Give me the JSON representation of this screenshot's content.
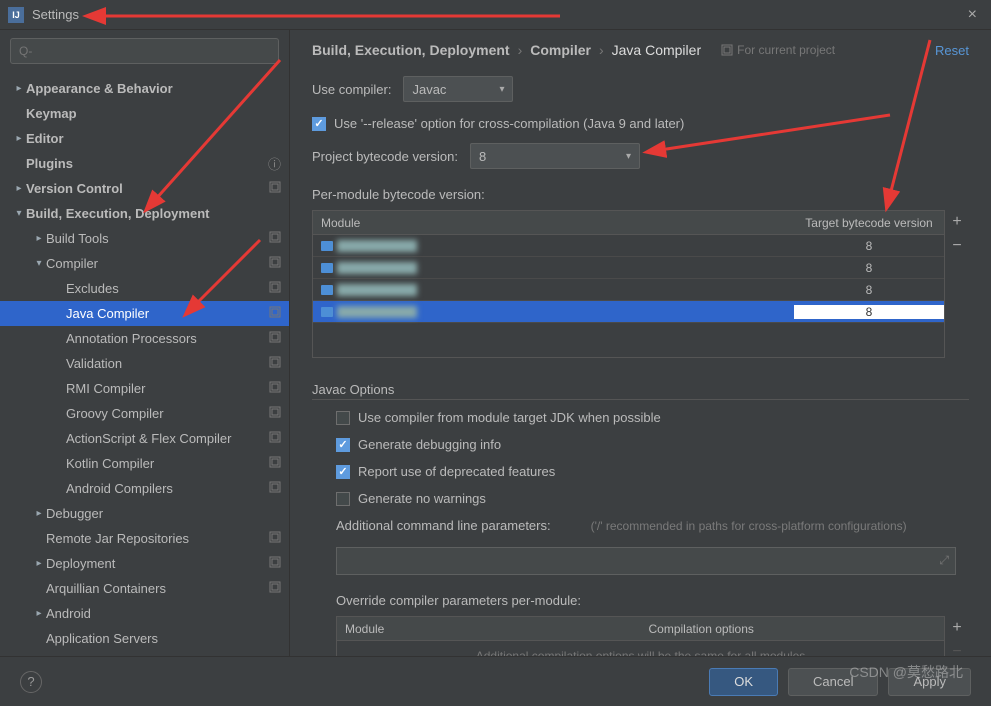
{
  "titlebar": {
    "title": "Settings",
    "close_icon": "×"
  },
  "search": {
    "placeholder": "Q-"
  },
  "sidebar": [
    {
      "label": "Appearance & Behavior",
      "lvl": 0,
      "arrow": "▸",
      "bold": true
    },
    {
      "label": "Keymap",
      "lvl": 0,
      "bold": true
    },
    {
      "label": "Editor",
      "lvl": 0,
      "arrow": "▸",
      "bold": true
    },
    {
      "label": "Plugins",
      "lvl": 0,
      "bold": true,
      "badge": true
    },
    {
      "label": "Version Control",
      "lvl": 0,
      "arrow": "▸",
      "bold": true,
      "proj": true
    },
    {
      "label": "Build, Execution, Deployment",
      "lvl": 0,
      "arrow": "▾",
      "bold": true
    },
    {
      "label": "Build Tools",
      "lvl": 1,
      "arrow": "▸",
      "proj": true
    },
    {
      "label": "Compiler",
      "lvl": 1,
      "arrow": "▾",
      "proj": true
    },
    {
      "label": "Excludes",
      "lvl": 2,
      "proj": true
    },
    {
      "label": "Java Compiler",
      "lvl": 2,
      "proj": true,
      "selected": true
    },
    {
      "label": "Annotation Processors",
      "lvl": 2,
      "proj": true
    },
    {
      "label": "Validation",
      "lvl": 2,
      "proj": true
    },
    {
      "label": "RMI Compiler",
      "lvl": 2,
      "proj": true
    },
    {
      "label": "Groovy Compiler",
      "lvl": 2,
      "proj": true
    },
    {
      "label": "ActionScript & Flex Compiler",
      "lvl": 2,
      "proj": true
    },
    {
      "label": "Kotlin Compiler",
      "lvl": 2,
      "proj": true
    },
    {
      "label": "Android Compilers",
      "lvl": 2,
      "proj": true
    },
    {
      "label": "Debugger",
      "lvl": 1,
      "arrow": "▸"
    },
    {
      "label": "Remote Jar Repositories",
      "lvl": 1,
      "proj": true
    },
    {
      "label": "Deployment",
      "lvl": 1,
      "arrow": "▸",
      "proj": true
    },
    {
      "label": "Arquillian Containers",
      "lvl": 1,
      "proj": true
    },
    {
      "label": "Android",
      "lvl": 1,
      "arrow": "▸"
    },
    {
      "label": "Application Servers",
      "lvl": 1
    }
  ],
  "breadcrumb": {
    "p1": "Build, Execution, Deployment",
    "p2": "Compiler",
    "p3": "Java Compiler"
  },
  "for_project": "For current project",
  "reset": "Reset",
  "use_compiler_label": "Use compiler:",
  "use_compiler_value": "Javac",
  "release_option": "Use '--release' option for cross-compilation (Java 9 and later)",
  "bytecode_label": "Project bytecode version:",
  "bytecode_value": "8",
  "per_module_label": "Per-module bytecode version:",
  "table_head": {
    "module": "Module",
    "target": "Target bytecode version"
  },
  "modules": [
    {
      "target": "8"
    },
    {
      "target": "8"
    },
    {
      "target": "8"
    },
    {
      "target": "8",
      "selected": true
    }
  ],
  "javac_section": "Javac Options",
  "opt1": {
    "label": "Use compiler from module target JDK when possible",
    "checked": false
  },
  "opt2": {
    "label": "Generate debugging info",
    "checked": true
  },
  "opt3": {
    "label": "Report use of deprecated features",
    "checked": true
  },
  "opt4": {
    "label": "Generate no warnings",
    "checked": false
  },
  "params_label": "Additional command line parameters:",
  "params_hint": "('/' recommended in paths for cross-platform configurations)",
  "override_label": "Override compiler parameters per-module:",
  "override_head": {
    "module": "Module",
    "opts": "Compilation options"
  },
  "override_empty": "Additional compilation options will be the same for all modules",
  "footer": {
    "ok": "OK",
    "cancel": "Cancel",
    "apply": "Apply"
  },
  "watermark": "CSDN @莫愁路北"
}
